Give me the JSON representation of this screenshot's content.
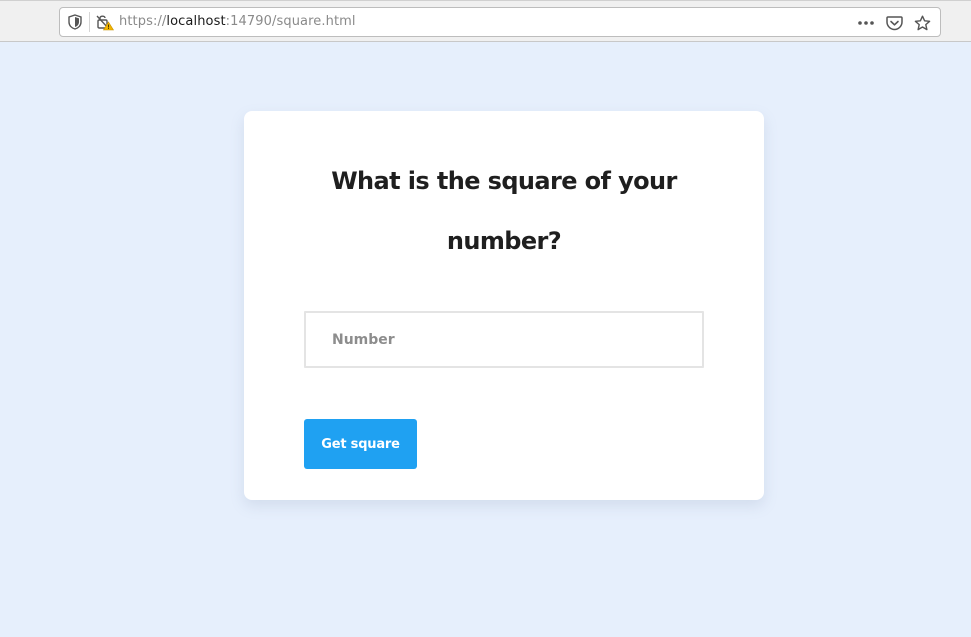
{
  "browser": {
    "url_scheme": "https://",
    "url_host": "localhost",
    "url_rest": ":14790/square.html",
    "icons": {
      "tracking": "shield-icon",
      "security": "insecure-lock-warning-icon",
      "more": "ellipsis-icon",
      "pocket": "pocket-icon",
      "bookmark": "star-icon"
    }
  },
  "card": {
    "heading": "What is the square of your number?",
    "input_placeholder": "Number",
    "input_value": "",
    "button_label": "Get square"
  },
  "colors": {
    "page_background": "#e6effc",
    "card_background": "#ffffff",
    "button_background": "#1fa1f2",
    "heading_text": "#1f1f1f"
  }
}
